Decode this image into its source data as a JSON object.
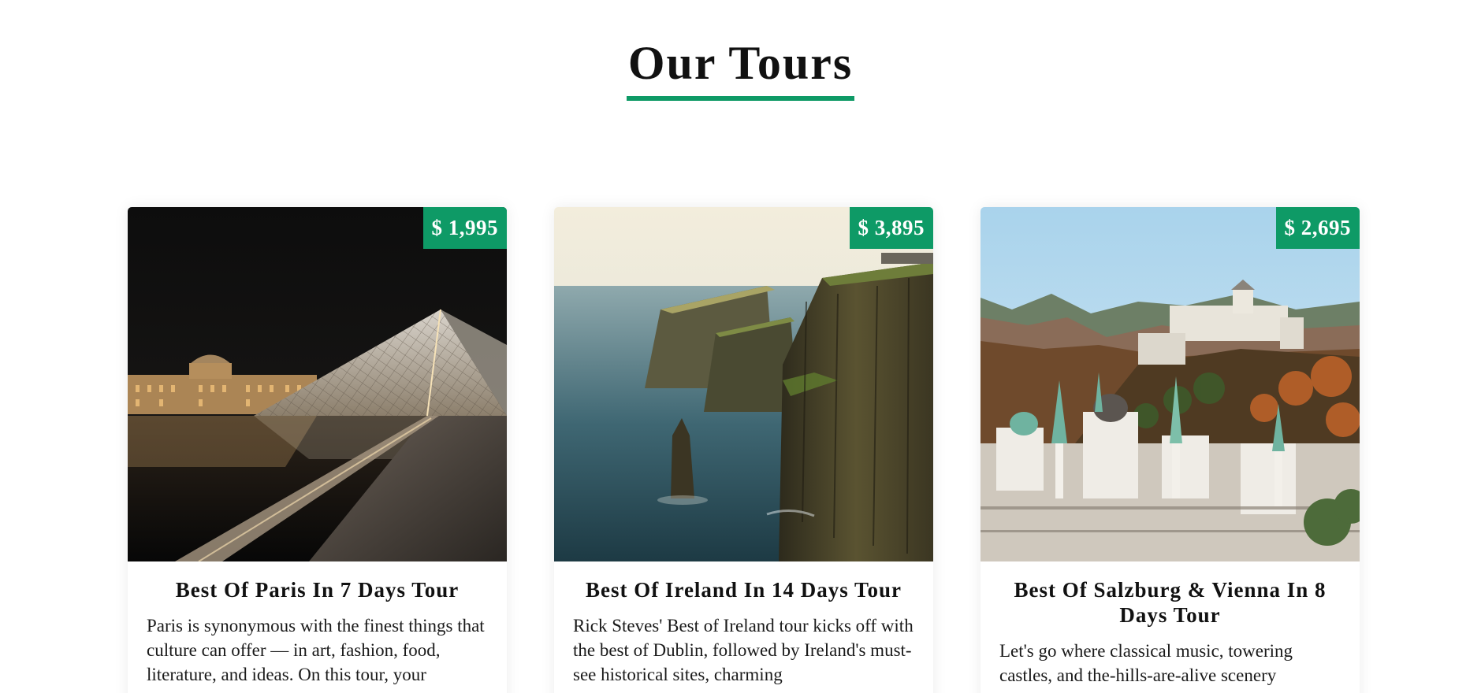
{
  "section": {
    "title": "Our Tours"
  },
  "colors": {
    "accent": "#0e9a66"
  },
  "tours": [
    {
      "price": "$ 1,995",
      "title": "Best Of Paris In 7 Days Tour",
      "description": "Paris is synonymous with the finest things that culture can offer — in art, fashion, food, literature, and ideas. On this tour, your",
      "image": "louvre-pyramid-night-photo"
    },
    {
      "price": "$ 3,895",
      "title": "Best Of Ireland In 14 Days Tour",
      "description": "Rick Steves' Best of Ireland tour kicks off with the best of Dublin, followed by Ireland's must-see historical sites, charming",
      "image": "cliffs-of-moher-photo"
    },
    {
      "price": "$ 2,695",
      "title": "Best Of Salzburg & Vienna In 8 Days Tour",
      "description": "Let's go where classical music, towering castles, and the-hills-are-alive scenery",
      "image": "salzburg-castle-cityscape-photo"
    }
  ]
}
